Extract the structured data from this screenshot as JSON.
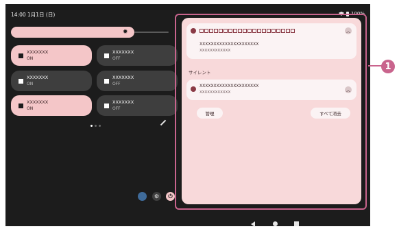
{
  "status": {
    "time_date": "14:00  1月1日 (日)",
    "battery": "100%"
  },
  "tiles": [
    {
      "name": "XXXXXXX",
      "state": "ON"
    },
    {
      "name": "XXXXXXX",
      "state": "OFF"
    },
    {
      "name": "XXXXXXX",
      "state": "ON"
    },
    {
      "name": "XXXXXXX",
      "state": "OFF"
    },
    {
      "name": "XXXXXXX",
      "state": "ON"
    },
    {
      "name": "XXXXXXX",
      "state": "OFF"
    }
  ],
  "notifications": {
    "card1": {
      "line1": "XXXXXXXXXXXXXXXXXXXXX",
      "line2": "XXXXXXXXXXXX"
    },
    "section_label": "サイレント",
    "card2": {
      "line1": "XXXXXXXXXXXXXXXXXXXXX",
      "line2": "XXXXXXXXXXXX"
    },
    "manage_label": "管理",
    "clear_all_label": "すべて消去"
  },
  "callout_number": "1",
  "icons": {
    "brightness": "sun-icon",
    "edit": "pencil-icon",
    "settings": "gear-icon",
    "power": "power-icon",
    "expand": "chevron-up-icon",
    "back": "back-triangle-icon",
    "home": "home-circle-icon",
    "recents": "recents-square-icon"
  },
  "colors": {
    "accent_pink": "#f4c6c8",
    "panel_bg": "#f8d9da",
    "callout": "#c9648d",
    "screen_bg": "#1c1c1c"
  }
}
